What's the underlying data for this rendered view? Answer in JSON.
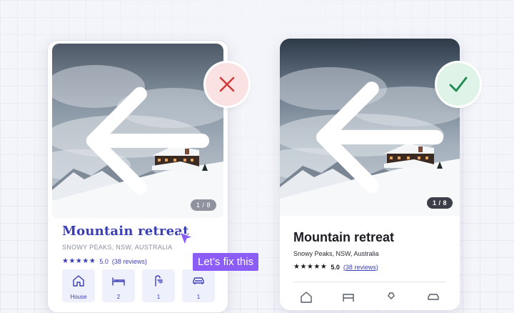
{
  "bad_card": {
    "title": "Mountain retreat",
    "location": "SNOWY PEAKS, NSW, AUSTRALIA",
    "stars": "★★★★★",
    "score": "5.0",
    "reviews": "(38 reviews)",
    "counter": "1 / 8",
    "amenities": [
      {
        "icon": "house-icon",
        "label": "House"
      },
      {
        "icon": "bed-icon",
        "label": "2"
      },
      {
        "icon": "shower-icon",
        "label": "1"
      },
      {
        "icon": "car-icon",
        "label": "1"
      }
    ]
  },
  "good_card": {
    "title": "Mountain retreat",
    "location": "Snowy Peaks, NSW, Australia",
    "stars": "★★★★★",
    "score": "5.0",
    "reviews": "(38 reviews)",
    "counter": "1 / 8",
    "icons": [
      "house-icon",
      "bed-icon",
      "shower-icon",
      "car-icon"
    ]
  },
  "annotation": {
    "tooltip": "Let’s fix this",
    "bad_badge": "x-icon",
    "good_badge": "check-icon"
  },
  "colors": {
    "accent": "#3b3fb6",
    "tooltip": "#8b5cf6",
    "error": "#d23a3a",
    "success": "#1e8a52"
  }
}
